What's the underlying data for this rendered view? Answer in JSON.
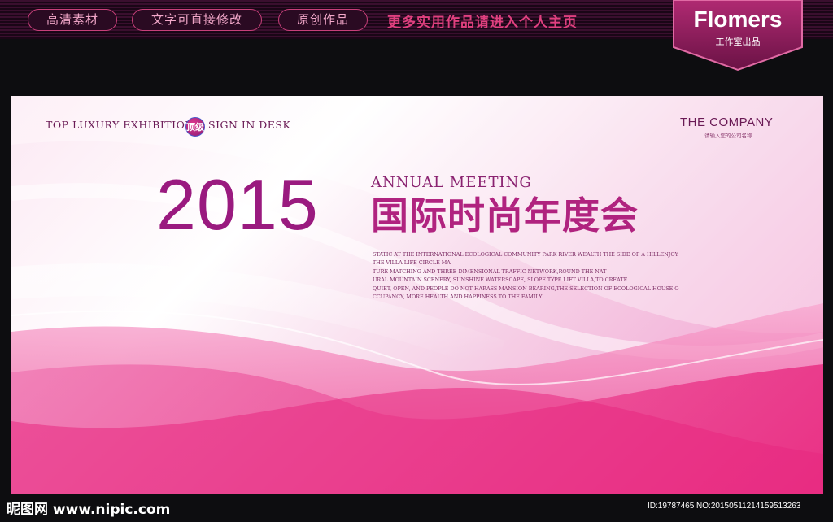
{
  "topbar": {
    "pill_1": "高清素材",
    "pill_2": "文字可直接修改",
    "pill_3": "原创作品",
    "link": "更多实用作品请进入个人主页"
  },
  "badge": {
    "name": "Flomers",
    "sub": "工作室出品"
  },
  "banner": {
    "tag_left": "TOP LUXURY EXHIBITION",
    "seal": "顶级",
    "tag_right": "SIGN IN DESK",
    "company": "THE COMPANY",
    "company_sub": "请输入您的公司名称",
    "year": "2015",
    "annual": "ANNUAL MEETING",
    "cn_title": "国际时尚年度会",
    "blurb": [
      "STATIC AT THE INTERNATIONAL ECOLOGICAL COMMUNITY PARK RIVER WEALTH THE SIDE OF A HILLENJOY",
      "THE VILLA LIFE CIRCLE MA",
      "TURE MATCHING AND THREE-DIMENSIONAL TRAFFIC NETWORK,ROUND THE NAT",
      "URAL MOUNTAIN SCENERY, SUNSHINE WATERSCAPE, SLOPE TYPE LIFT VILLA,TO CREATE",
      "QUIET, OPEN, AND PEOPLE DO NOT HARASS MANSION BEARING,THE SELECTION OF ECOLOGICAL HOUSE O",
      "CCUPANCY, MORE HEALTH AND HAPPINESS TO THE FAMILY."
    ]
  },
  "footer": {
    "logo": "昵图网 www.nipic.com",
    "id_text": "ID:19787465 NO:20150511214159513263"
  },
  "colors": {
    "accent": "#b0237f",
    "pink_pill_border": "#c8407a",
    "banner_pink": "#e8287f"
  }
}
